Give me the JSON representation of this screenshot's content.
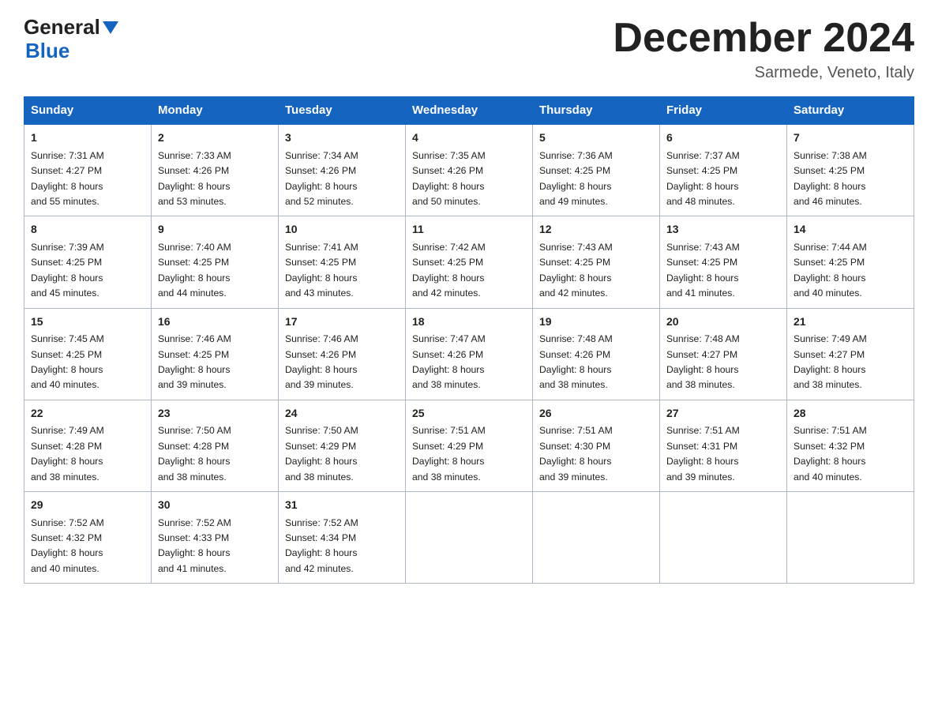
{
  "header": {
    "logo_general": "General",
    "logo_blue": "Blue",
    "month_title": "December 2024",
    "location": "Sarmede, Veneto, Italy"
  },
  "days_of_week": [
    "Sunday",
    "Monday",
    "Tuesday",
    "Wednesday",
    "Thursday",
    "Friday",
    "Saturday"
  ],
  "weeks": [
    [
      {
        "day": "1",
        "sunrise": "7:31 AM",
        "sunset": "4:27 PM",
        "daylight": "8 hours and 55 minutes."
      },
      {
        "day": "2",
        "sunrise": "7:33 AM",
        "sunset": "4:26 PM",
        "daylight": "8 hours and 53 minutes."
      },
      {
        "day": "3",
        "sunrise": "7:34 AM",
        "sunset": "4:26 PM",
        "daylight": "8 hours and 52 minutes."
      },
      {
        "day": "4",
        "sunrise": "7:35 AM",
        "sunset": "4:26 PM",
        "daylight": "8 hours and 50 minutes."
      },
      {
        "day": "5",
        "sunrise": "7:36 AM",
        "sunset": "4:25 PM",
        "daylight": "8 hours and 49 minutes."
      },
      {
        "day": "6",
        "sunrise": "7:37 AM",
        "sunset": "4:25 PM",
        "daylight": "8 hours and 48 minutes."
      },
      {
        "day": "7",
        "sunrise": "7:38 AM",
        "sunset": "4:25 PM",
        "daylight": "8 hours and 46 minutes."
      }
    ],
    [
      {
        "day": "8",
        "sunrise": "7:39 AM",
        "sunset": "4:25 PM",
        "daylight": "8 hours and 45 minutes."
      },
      {
        "day": "9",
        "sunrise": "7:40 AM",
        "sunset": "4:25 PM",
        "daylight": "8 hours and 44 minutes."
      },
      {
        "day": "10",
        "sunrise": "7:41 AM",
        "sunset": "4:25 PM",
        "daylight": "8 hours and 43 minutes."
      },
      {
        "day": "11",
        "sunrise": "7:42 AM",
        "sunset": "4:25 PM",
        "daylight": "8 hours and 42 minutes."
      },
      {
        "day": "12",
        "sunrise": "7:43 AM",
        "sunset": "4:25 PM",
        "daylight": "8 hours and 42 minutes."
      },
      {
        "day": "13",
        "sunrise": "7:43 AM",
        "sunset": "4:25 PM",
        "daylight": "8 hours and 41 minutes."
      },
      {
        "day": "14",
        "sunrise": "7:44 AM",
        "sunset": "4:25 PM",
        "daylight": "8 hours and 40 minutes."
      }
    ],
    [
      {
        "day": "15",
        "sunrise": "7:45 AM",
        "sunset": "4:25 PM",
        "daylight": "8 hours and 40 minutes."
      },
      {
        "day": "16",
        "sunrise": "7:46 AM",
        "sunset": "4:25 PM",
        "daylight": "8 hours and 39 minutes."
      },
      {
        "day": "17",
        "sunrise": "7:46 AM",
        "sunset": "4:26 PM",
        "daylight": "8 hours and 39 minutes."
      },
      {
        "day": "18",
        "sunrise": "7:47 AM",
        "sunset": "4:26 PM",
        "daylight": "8 hours and 38 minutes."
      },
      {
        "day": "19",
        "sunrise": "7:48 AM",
        "sunset": "4:26 PM",
        "daylight": "8 hours and 38 minutes."
      },
      {
        "day": "20",
        "sunrise": "7:48 AM",
        "sunset": "4:27 PM",
        "daylight": "8 hours and 38 minutes."
      },
      {
        "day": "21",
        "sunrise": "7:49 AM",
        "sunset": "4:27 PM",
        "daylight": "8 hours and 38 minutes."
      }
    ],
    [
      {
        "day": "22",
        "sunrise": "7:49 AM",
        "sunset": "4:28 PM",
        "daylight": "8 hours and 38 minutes."
      },
      {
        "day": "23",
        "sunrise": "7:50 AM",
        "sunset": "4:28 PM",
        "daylight": "8 hours and 38 minutes."
      },
      {
        "day": "24",
        "sunrise": "7:50 AM",
        "sunset": "4:29 PM",
        "daylight": "8 hours and 38 minutes."
      },
      {
        "day": "25",
        "sunrise": "7:51 AM",
        "sunset": "4:29 PM",
        "daylight": "8 hours and 38 minutes."
      },
      {
        "day": "26",
        "sunrise": "7:51 AM",
        "sunset": "4:30 PM",
        "daylight": "8 hours and 39 minutes."
      },
      {
        "day": "27",
        "sunrise": "7:51 AM",
        "sunset": "4:31 PM",
        "daylight": "8 hours and 39 minutes."
      },
      {
        "day": "28",
        "sunrise": "7:51 AM",
        "sunset": "4:32 PM",
        "daylight": "8 hours and 40 minutes."
      }
    ],
    [
      {
        "day": "29",
        "sunrise": "7:52 AM",
        "sunset": "4:32 PM",
        "daylight": "8 hours and 40 minutes."
      },
      {
        "day": "30",
        "sunrise": "7:52 AM",
        "sunset": "4:33 PM",
        "daylight": "8 hours and 41 minutes."
      },
      {
        "day": "31",
        "sunrise": "7:52 AM",
        "sunset": "4:34 PM",
        "daylight": "8 hours and 42 minutes."
      },
      null,
      null,
      null,
      null
    ]
  ],
  "labels": {
    "sunrise": "Sunrise:",
    "sunset": "Sunset:",
    "daylight": "Daylight:"
  }
}
